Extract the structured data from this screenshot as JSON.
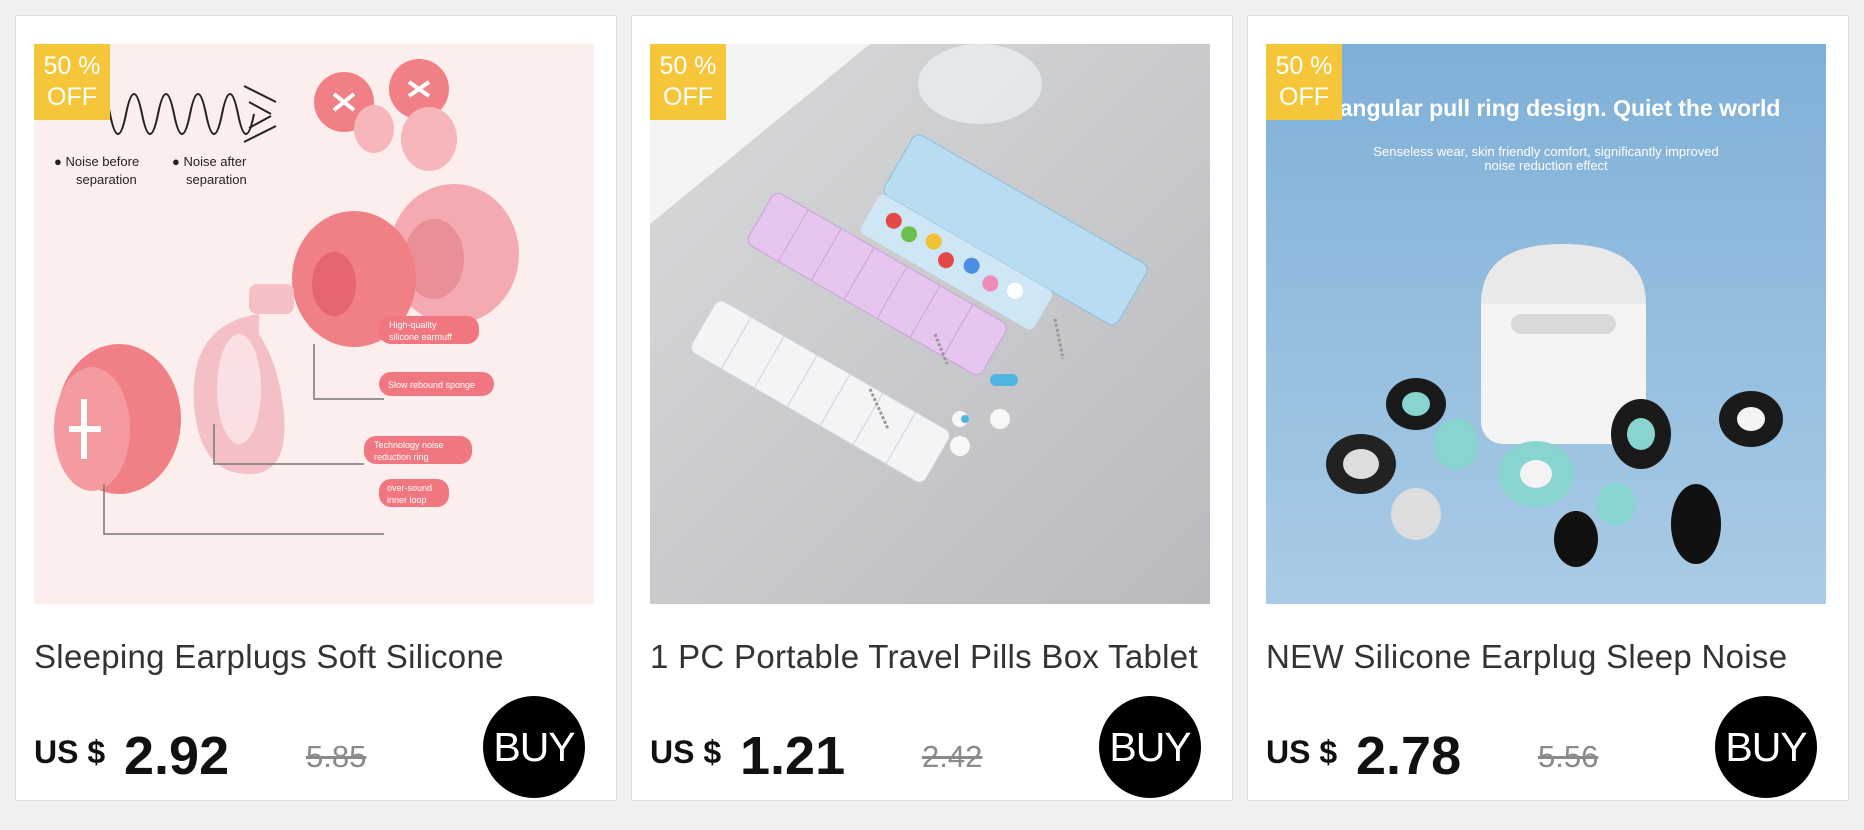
{
  "products": [
    {
      "image_alt": "Sleeping earplugs exploded diagram",
      "badge_line1": "50 %",
      "badge_line2": "OFF",
      "title": "Sleeping Earplugs Soft Silicone",
      "currency": "US $",
      "price": "2.92",
      "original_price": "5.85",
      "buy_label": "BUY",
      "image_texts": {
        "noise_before": "● Noise before",
        "noise_before2": "separation",
        "noise_after": "● Noise after",
        "noise_after2": "separation",
        "label1a": "High-quality",
        "label1b": "silicone earmuff",
        "label2": "Slow rebound sponge",
        "label3a": "Technology noise",
        "label3b": "reduction ring",
        "label4a": "over-sound",
        "label4b": "inner loop"
      }
    },
    {
      "image_alt": "Pill organizer boxes",
      "badge_line1": "50 %",
      "badge_line2": "OFF",
      "title": "1 PC Portable Travel Pills Box Tablet",
      "currency": "US $",
      "price": "1.21",
      "original_price": "2.42",
      "buy_label": "BUY"
    },
    {
      "image_alt": "Silicone earplugs with charging case",
      "badge_line1": "50 %",
      "badge_line2": "OFF",
      "title": "NEW Silicone Earplug Sleep Noise",
      "currency": "US $",
      "price": "2.78",
      "original_price": "5.56",
      "buy_label": "BUY",
      "image_texts": {
        "headline": "Triangular pull ring design. Quiet the world",
        "sub1": "Senseless wear, skin friendly comfort, significantly improved",
        "sub2": "noise reduction effect"
      }
    }
  ],
  "colors": {
    "badge": "#f5c53a",
    "buy": "#000000",
    "page_bg": "#f0f0f0"
  }
}
